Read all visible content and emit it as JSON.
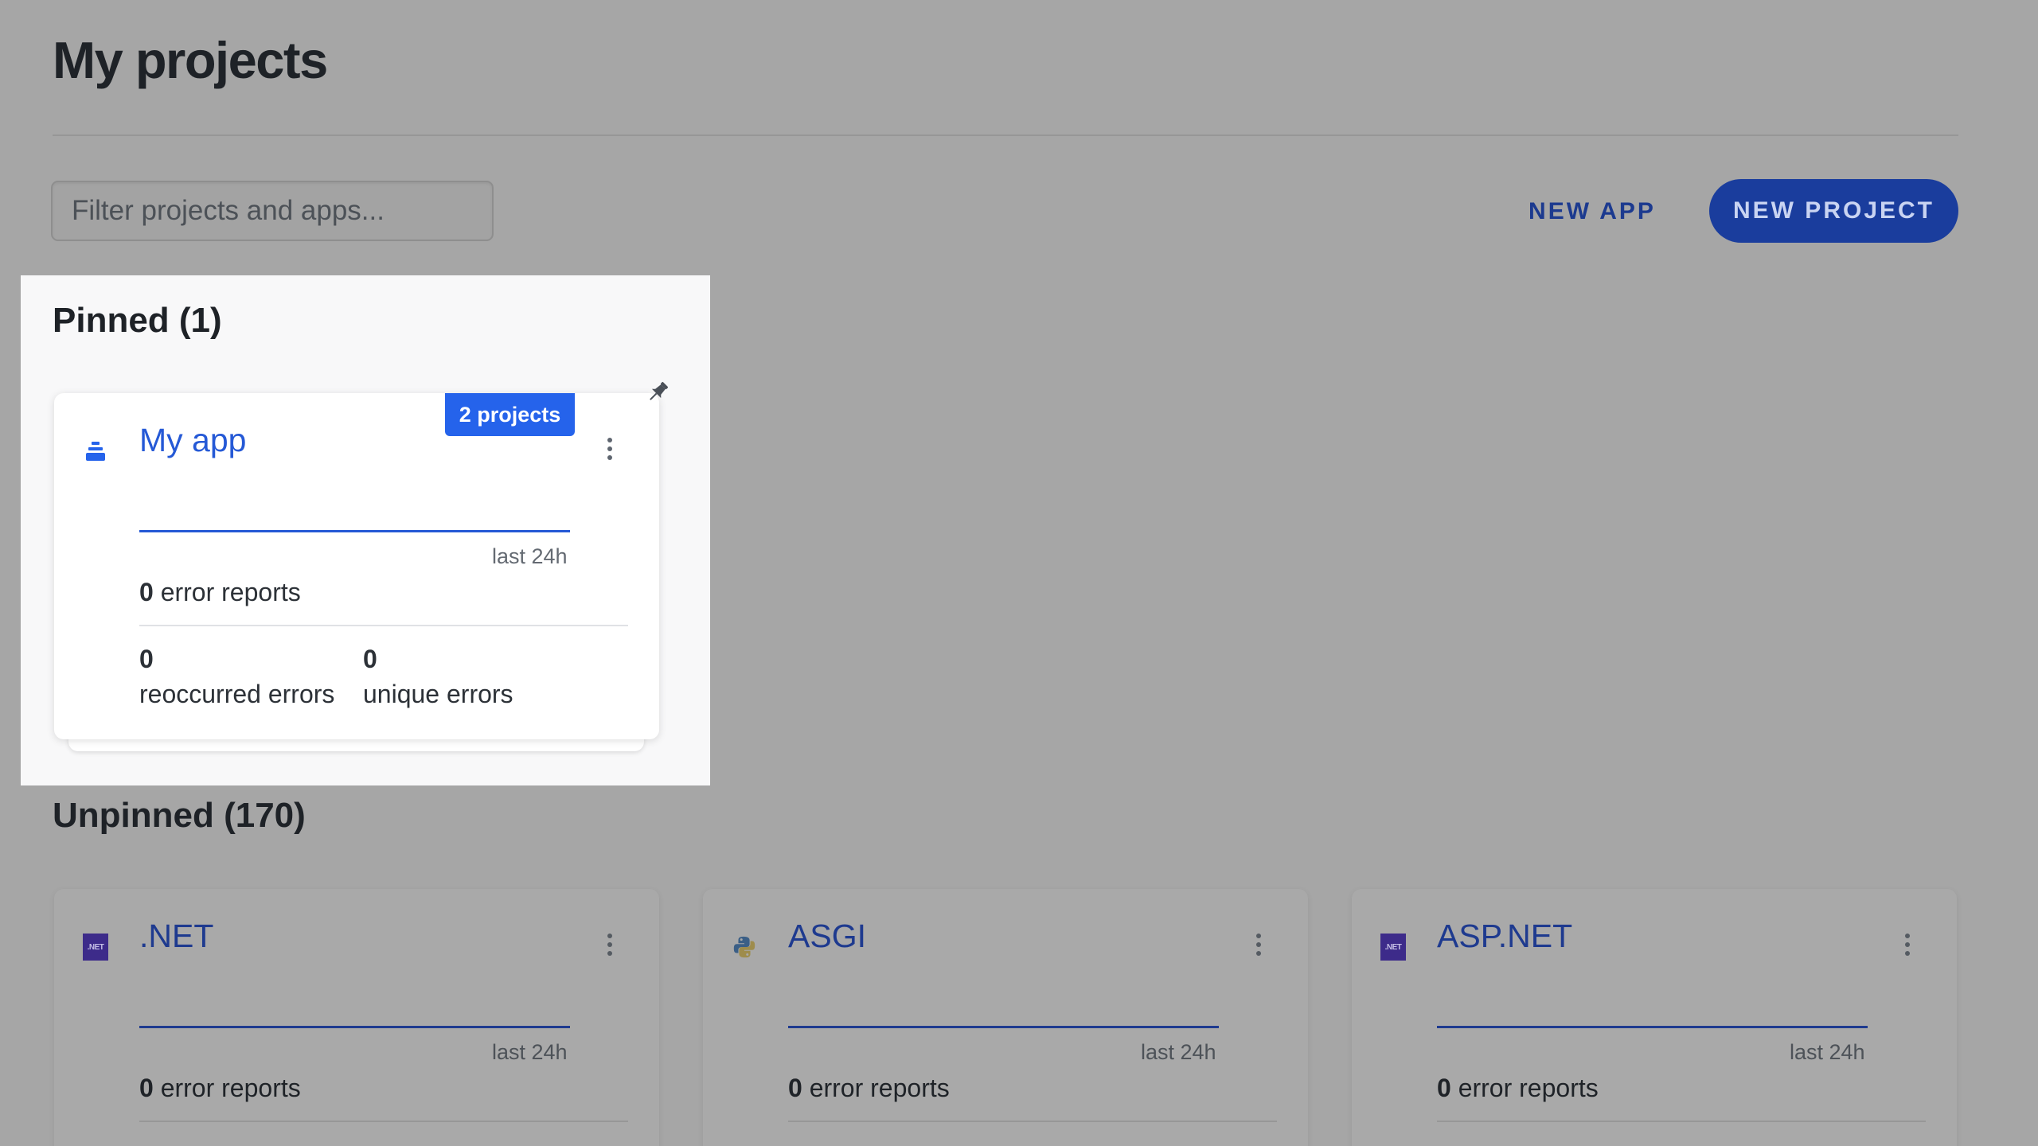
{
  "page": {
    "title": "My projects"
  },
  "toolbar": {
    "filter_placeholder": "Filter projects and apps...",
    "new_app_label": "NEW APP",
    "new_project_label": "NEW PROJECT"
  },
  "pinned": {
    "heading": "Pinned (1)",
    "card": {
      "icon": "app-stack-icon",
      "title": "My app",
      "badge": "2 projects",
      "period": "last 24h",
      "error_reports_count": "0",
      "error_reports_label": "error reports",
      "reoccurred_count": "0",
      "reoccurred_label": "reoccurred errors",
      "unique_count": "0",
      "unique_label": "unique errors"
    }
  },
  "unpinned": {
    "heading": "Unpinned (170)",
    "cards": [
      {
        "icon": "dotnet-icon",
        "logo_text": ".NET",
        "title": ".NET",
        "period": "last 24h",
        "error_reports_count": "0",
        "error_reports_label": "error reports"
      },
      {
        "icon": "python-icon",
        "title": "ASGI",
        "period": "last 24h",
        "error_reports_count": "0",
        "error_reports_label": "error reports"
      },
      {
        "icon": "dotnet-icon",
        "logo_text": ".NET",
        "title": "ASP.NET",
        "period": "last 24h",
        "error_reports_count": "0",
        "error_reports_label": "error reports"
      }
    ]
  },
  "colors": {
    "accent": "#2563eb",
    "link": "#2559d6",
    "primary_button": "#1a3d9d",
    "overlay_background": "#a6a6a6"
  }
}
